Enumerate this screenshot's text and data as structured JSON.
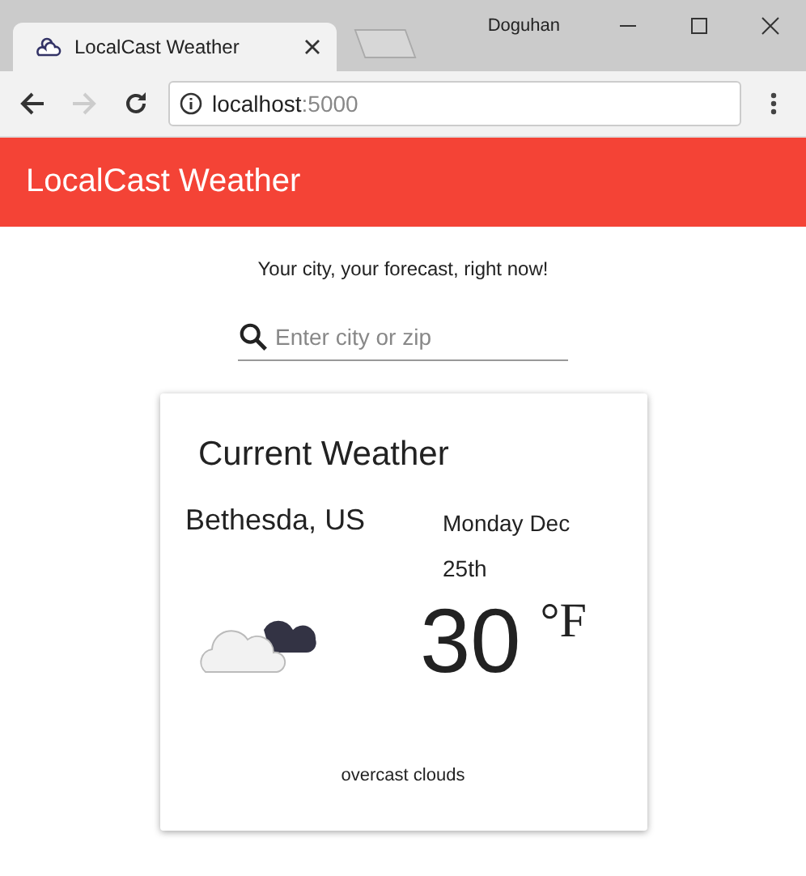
{
  "window": {
    "user": "Doguhan"
  },
  "tabs": [
    {
      "title": "LocalCast Weather",
      "selected": true
    }
  ],
  "address_bar": {
    "host": "localhost",
    "port": ":5000"
  },
  "toolbar": {
    "title": "LocalCast Weather"
  },
  "tagline": "Your city, your forecast, right now!",
  "search": {
    "placeholder": "Enter city or zip"
  },
  "card": {
    "title": "Current Weather",
    "city": "Bethesda, US",
    "date": "Monday Dec 25th",
    "temperature": "30",
    "unit": "°F",
    "description": "overcast clouds"
  }
}
